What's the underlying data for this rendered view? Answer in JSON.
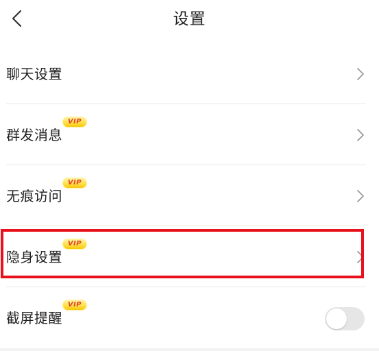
{
  "header": {
    "title": "设置",
    "back_icon": "chevron-left-icon"
  },
  "rows": [
    {
      "label": "聊天设置",
      "vip": false,
      "control": "chevron"
    },
    {
      "label": "群发消息",
      "vip": true,
      "control": "chevron"
    },
    {
      "label": "无痕访问",
      "vip": true,
      "control": "chevron"
    },
    {
      "label": "隐身设置",
      "vip": true,
      "control": "chevron"
    },
    {
      "label": "截屏提醒",
      "vip": true,
      "control": "toggle",
      "toggle_on": false
    }
  ],
  "badge": {
    "text": "VIP"
  },
  "colors": {
    "highlight": "#e8101b",
    "vip_gradient_top": "#fff6b0",
    "vip_gradient_bottom": "#f5c400",
    "vip_text": "#e0412a",
    "toggle_off": "#e6e6e6",
    "divider": "#e8e8e8"
  }
}
